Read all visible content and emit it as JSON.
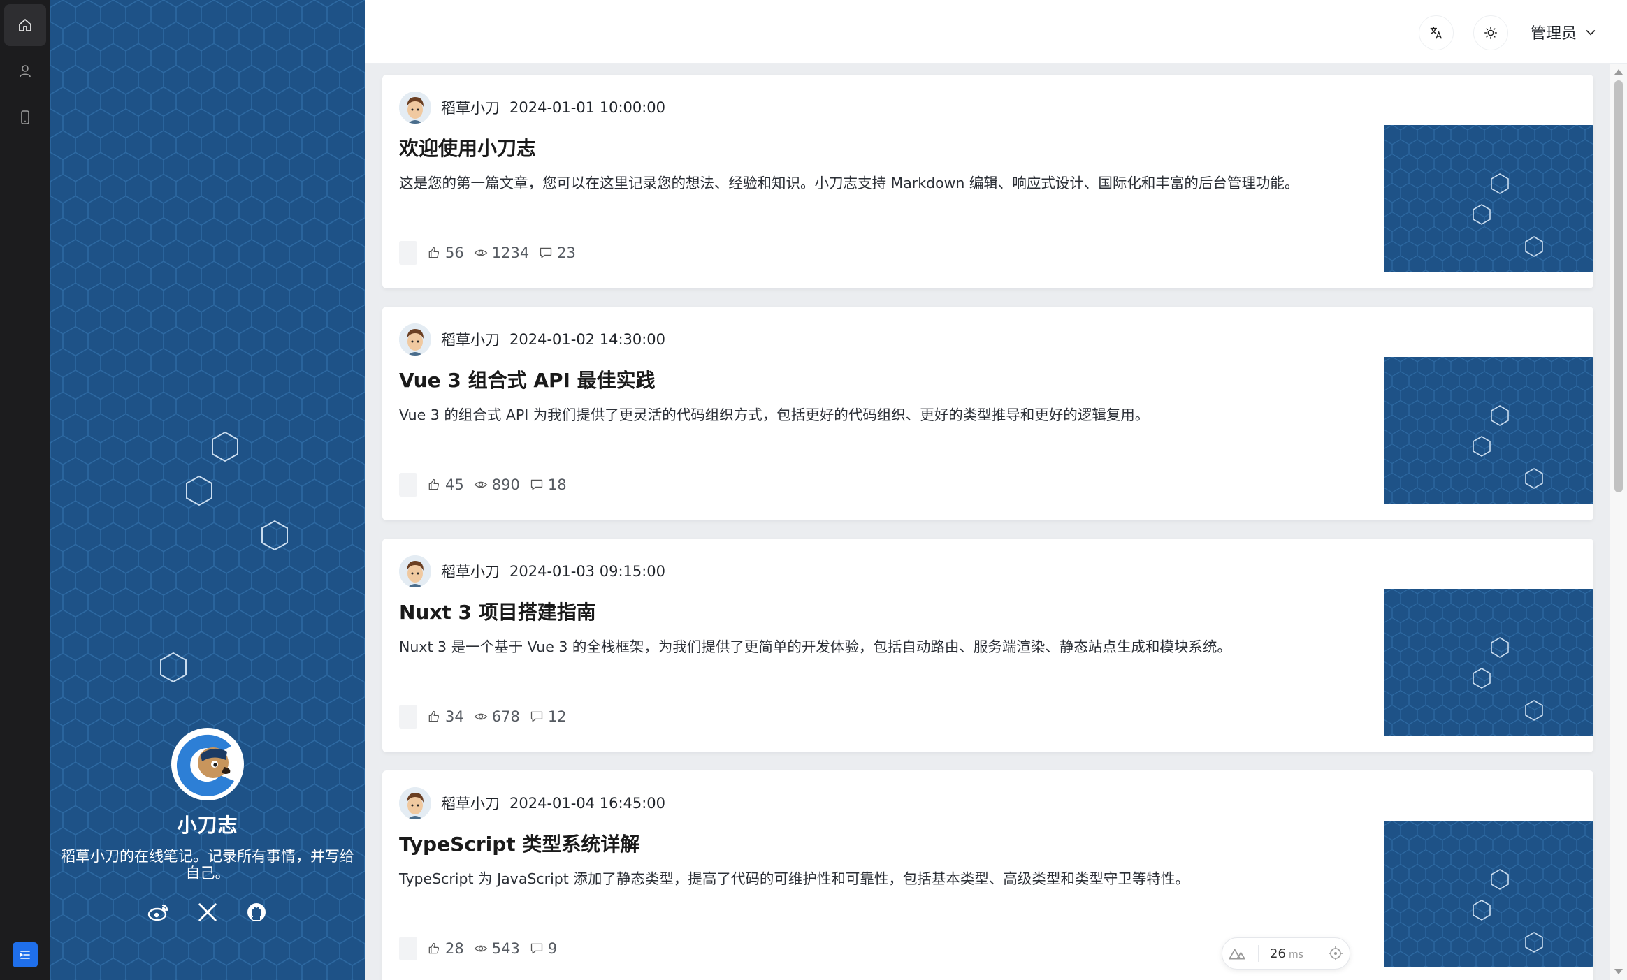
{
  "rail": {
    "items": [
      "home-icon",
      "user-icon",
      "mobile-icon"
    ],
    "bottom_icon": "menu-icon"
  },
  "profile": {
    "name": "小刀志",
    "description": "稻草小刀的在线笔记。记录所有事情，并写给自己。",
    "socials": [
      "weibo-icon",
      "x-icon",
      "github-icon"
    ]
  },
  "header": {
    "translate_icon": "translate-icon",
    "theme_icon": "sun-icon",
    "user_label": "管理员"
  },
  "posts": [
    {
      "author": "稻草小刀",
      "date": "2024-01-01 10:00:00",
      "title": "欢迎使用小刀志",
      "excerpt": "这是您的第一篇文章，您可以在这里记录您的想法、经验和知识。小刀志支持 Markdown 编辑、响应式设计、国际化和丰富的后台管理功能。",
      "likes": "56",
      "views": "1234",
      "comments": "23"
    },
    {
      "author": "稻草小刀",
      "date": "2024-01-02 14:30:00",
      "title": "Vue 3 组合式 API 最佳实践",
      "excerpt": "Vue 3 的组合式 API 为我们提供了更灵活的代码组织方式，包括更好的代码组织、更好的类型推导和更好的逻辑复用。",
      "likes": "45",
      "views": "890",
      "comments": "18"
    },
    {
      "author": "稻草小刀",
      "date": "2024-01-03 09:15:00",
      "title": "Nuxt 3 项目搭建指南",
      "excerpt": "Nuxt 3 是一个基于 Vue 3 的全栈框架，为我们提供了更简单的开发体验，包括自动路由、服务端渲染、静态站点生成和模块系统。",
      "likes": "34",
      "views": "678",
      "comments": "12"
    },
    {
      "author": "稻草小刀",
      "date": "2024-01-04 16:45:00",
      "title": "TypeScript 类型系统详解",
      "excerpt": "TypeScript 为 JavaScript 添加了静态类型，提高了代码的可维护性和可靠性，包括基本类型、高级类型和类型守卫等特性。",
      "likes": "28",
      "views": "543",
      "comments": "9"
    }
  ],
  "devtools": {
    "time_value": "26",
    "time_unit": "ms"
  },
  "colors": {
    "sidebar_blue": "#1e5287",
    "rail": "#1c1c1e",
    "accent": "#1f6feb"
  }
}
